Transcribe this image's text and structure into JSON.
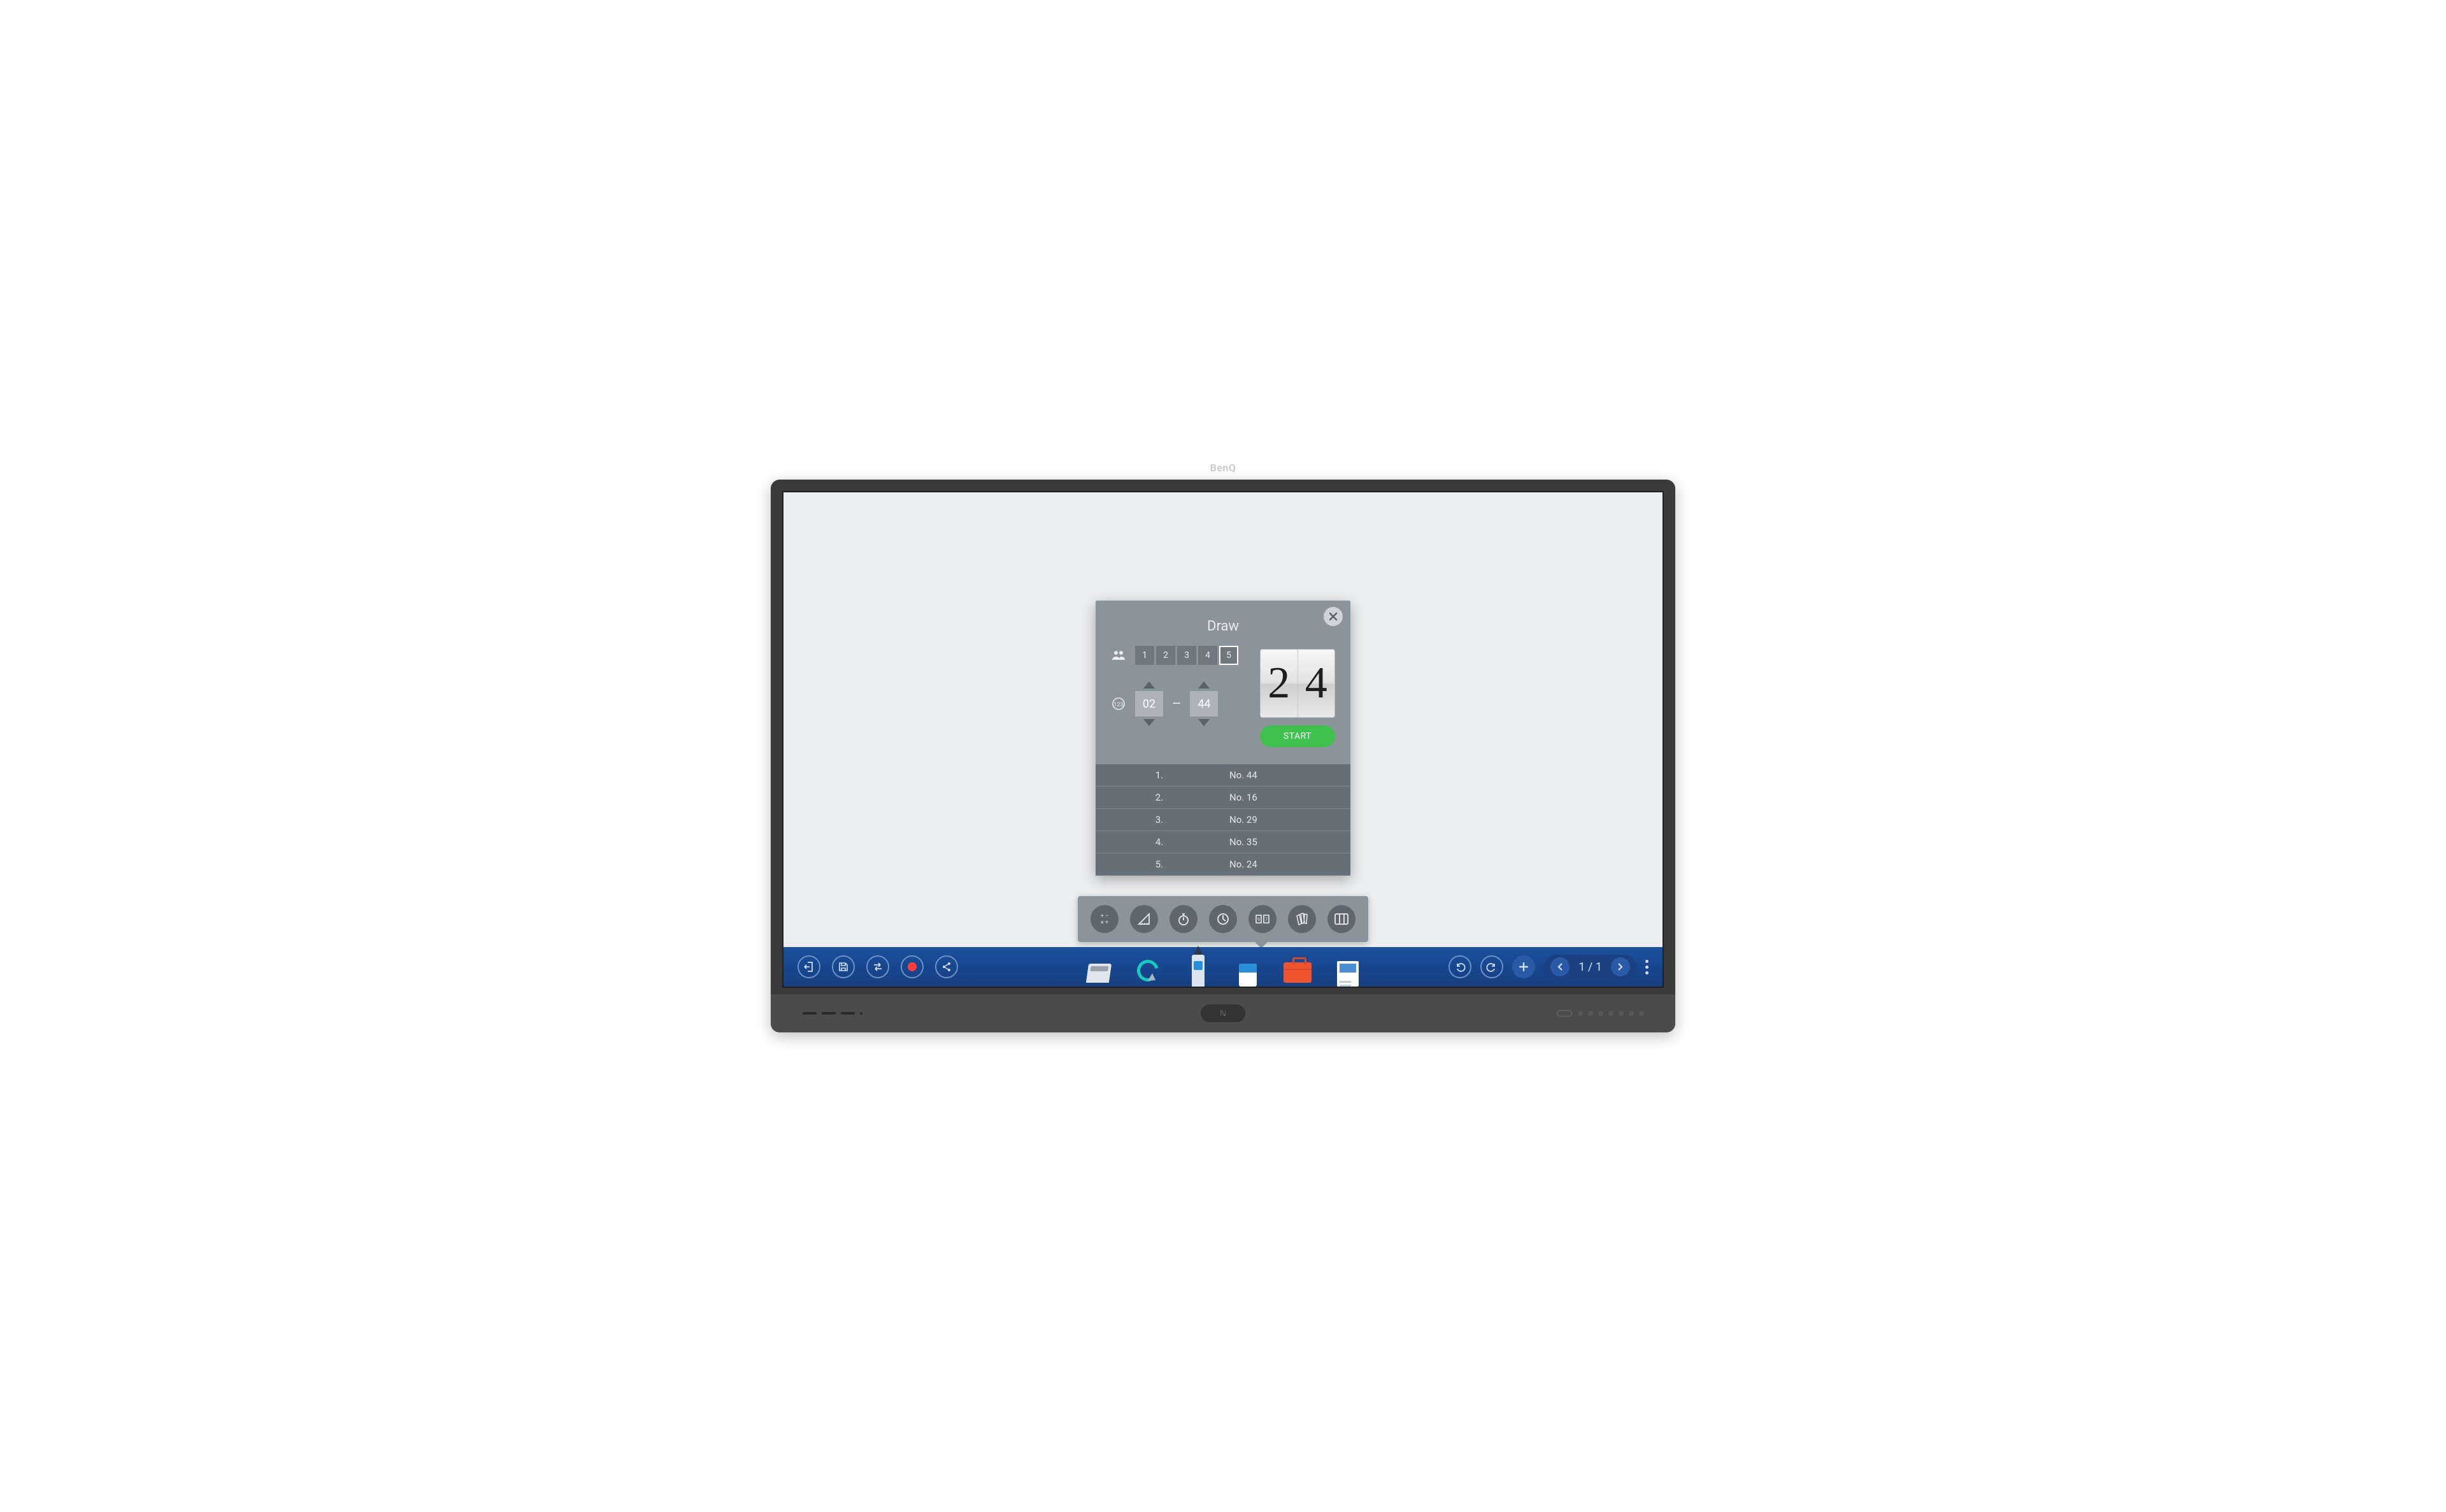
{
  "brand": "BenQ",
  "dialog": {
    "title": "Draw",
    "people_options": [
      "1",
      "2",
      "3",
      "4",
      "5"
    ],
    "people_selected_index": 4,
    "range_from": "02",
    "range_to": "44",
    "range_separator": "–",
    "result_digits": [
      "2",
      "4"
    ],
    "start_label": "START",
    "results": [
      {
        "index": "1.",
        "value": "No. 44"
      },
      {
        "index": "2.",
        "value": "No. 16"
      },
      {
        "index": "3.",
        "value": "No. 29"
      },
      {
        "index": "4.",
        "value": "No. 35"
      },
      {
        "index": "5.",
        "value": "No. 24"
      }
    ]
  },
  "page_nav": {
    "label": "1 / 1"
  },
  "nfc_label": "ℕ"
}
